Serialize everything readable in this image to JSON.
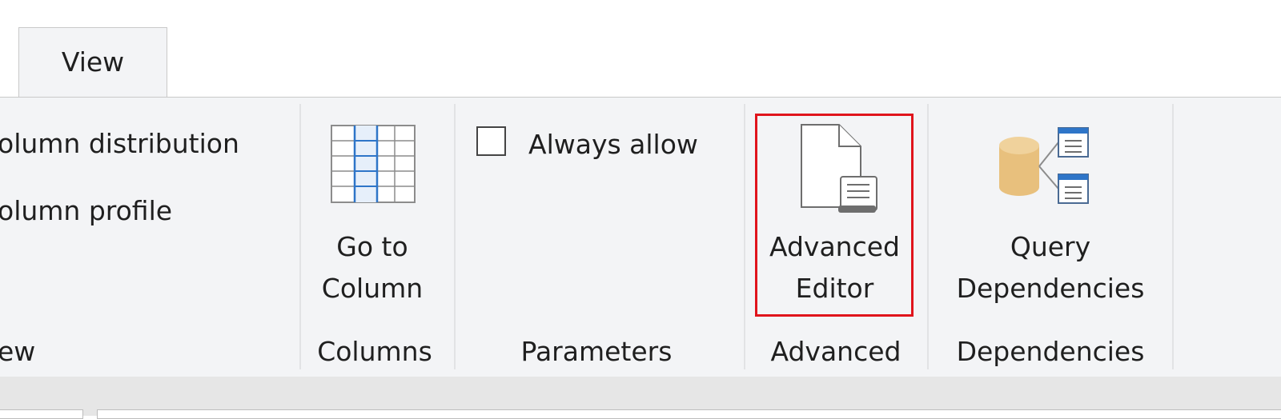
{
  "tabs": {
    "active": "View"
  },
  "layout_group": {
    "item_distribution": "olumn distribution",
    "item_profile": "olumn profile",
    "group_label": "ew"
  },
  "columns_group": {
    "button_line1": "Go to",
    "button_line2": "Column",
    "group_label": "Columns"
  },
  "parameters_group": {
    "checkbox_label": "Always allow",
    "checked": false,
    "group_label": "Parameters"
  },
  "advanced_group": {
    "button_line1": "Advanced",
    "button_line2": "Editor",
    "group_label": "Advanced",
    "highlighted": true,
    "highlight_color": "#e0141c"
  },
  "dependencies_group": {
    "button_line1": "Query",
    "button_line2": "Dependencies",
    "group_label": "Dependencies"
  },
  "icons": {
    "go_to_column": "table-column-icon",
    "advanced_editor": "script-document-icon",
    "query_dependencies": "database-dependencies-icon"
  },
  "colors": {
    "ribbon_bg": "#f3f4f6",
    "accent_blue": "#2e75c8",
    "db_gold": "#e8c07d"
  }
}
